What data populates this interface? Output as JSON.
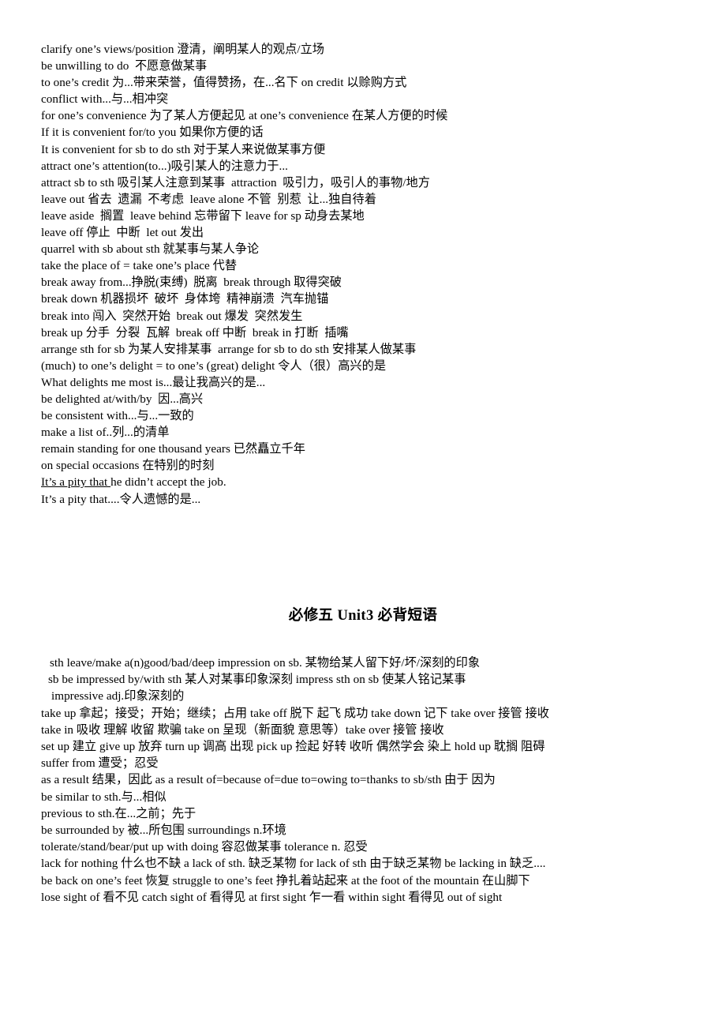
{
  "document": {
    "title": "必修五 Unit3 必背短语",
    "background_color": "#ffffff",
    "text_color": "#000000"
  },
  "section_one": {
    "lines": [
      "clarify one’s views/position 澄清，阐明某人的观点/立场",
      "be unwilling to do  不愿意做某事",
      "to one’s credit 为...带来荣誉，值得赞扬，在...名下 on credit 以赊购方式",
      "conflict with...与...相冲突",
      "for one’s convenience 为了某人方便起见 at one’s convenience 在某人方便的时候",
      "If it is convenient for/to you 如果你方便的话",
      "It is convenient for sb to do sth 对于某人来说做某事方便",
      "attract one’s attention(to...)吸引某人的注意力于...",
      "attract sb to sth 吸引某人注意到某事  attraction  吸引力，吸引人的事物/地方",
      "leave out 省去  遗漏  不考虑  leave alone 不管  别惹  让...独自待着",
      "leave aside  搁置  leave behind 忘带留下 leave for sp 动身去某地",
      "leave off 停止  中断  let out 发出",
      "quarrel with sb about sth 就某事与某人争论",
      "take the place of = take one’s place 代替",
      "break away from...挣脱(束缚)  脱离  break through 取得突破",
      "break down 机器损坏  破坏  身体垮  精神崩溃  汽车抛锚",
      "break into 闯入  突然开始  break out 爆发  突然发生",
      "break up 分手  分裂  瓦解  break off 中断  break in 打断  插嘴",
      "arrange sth for sb 为某人安排某事  arrange for sb to do sth 安排某人做某事",
      "(much) to one’s delight = to one’s (great) delight 令人（很）高兴的是",
      "What delights me most is...最让我高兴的是...",
      "be delighted at/with/by  因...高兴",
      "be consistent with...与...一致的",
      "make a list of..列...的清单",
      "remain standing for one thousand years 已然矗立千年",
      "on special occasions 在特别的时刻"
    ],
    "underlined_line": {
      "underlined_text": "It’s a pity that ",
      "rest_text": "he didn’t accept the job."
    },
    "last_line": "It’s a pity that....令人遗憾的是..."
  },
  "section_two": {
    "lines": [
      "sth leave/make a(n)good/bad/deep impression on sb. 某物给某人留下好/坏/深刻的印象",
      "sb be impressed by/with sth 某人对某事印象深刻 impress sth on sb 使某人铭记某事",
      "impressive adj.印象深刻的",
      "take up  拿起；接受；开始；继续；占用  take off 脱下  起飞  成功  take down 记下  take over  接管  接收",
      "take in 吸收  理解  收留  欺骗  take on 呈现（新面貌  意思等）take over  接管  接收",
      "set up  建立  give up 放弃  turn up 调高  出现  pick up 捡起  好转  收听  偶然学会  染上  hold up 耽搁  阻碍",
      "suffer from  遭受；忍受",
      "as a result  结果，因此    as a result of=because of=due to=owing to=thanks to sb/sth 由于  因为",
      "be similar to sth.与...相似",
      "previous to sth.在...之前；先于",
      "be surrounded by  被...所包围  surroundings    n.环境",
      "tolerate/stand/bear/put up with doing  容忍做某事    tolerance    n.  忍受",
      "lack for nothing  什么也不缺  a lack of sth. 缺乏某物  for lack of sth  由于缺乏某物  be lacking in  缺乏....",
      "be back on one’s feet  恢复    struggle to one’s feet  挣扎着站起来  at the foot of the mountain 在山脚下",
      "lose sight of  看不见    catch sight of  看得见  at first sight 乍一看    within sight  看得见      out of sight"
    ]
  }
}
